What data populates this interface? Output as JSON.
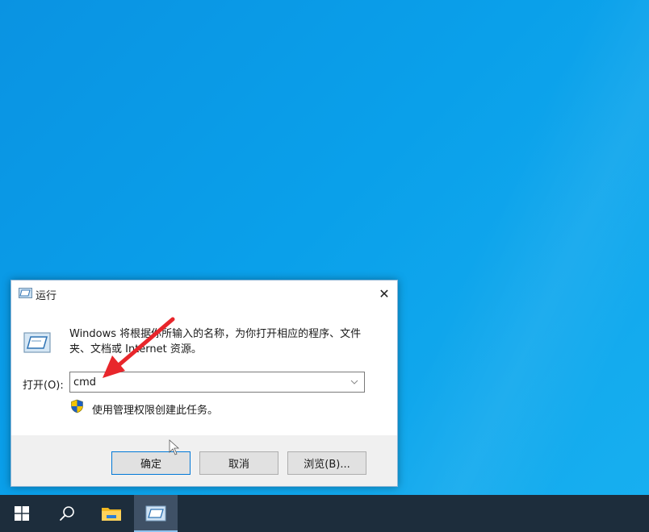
{
  "dialog": {
    "title": "运行",
    "description": "Windows 将根据你所输入的名称，为你打开相应的程序、文件夹、文档或 Internet 资源。",
    "open_label": "打开(O):",
    "input_value": "cmd",
    "admin_note": "使用管理权限创建此任务。",
    "buttons": {
      "ok": "确定",
      "cancel": "取消",
      "browse": "浏览(B)..."
    },
    "close_glyph": "✕"
  },
  "icons": {
    "title": "run-icon",
    "big": "run-icon",
    "shield": "uac-shield-icon",
    "close": "close-icon",
    "dropdown": "chevron-down-icon"
  },
  "taskbar": {
    "items": [
      "start-button",
      "search-button",
      "file-explorer",
      "run"
    ]
  },
  "colors": {
    "desktop": "#0a9be6",
    "taskbar": "#1d2d3c",
    "taskbar_active": "#3f5166",
    "accent": "#0078d7",
    "annotation_arrow": "#e8262b"
  }
}
